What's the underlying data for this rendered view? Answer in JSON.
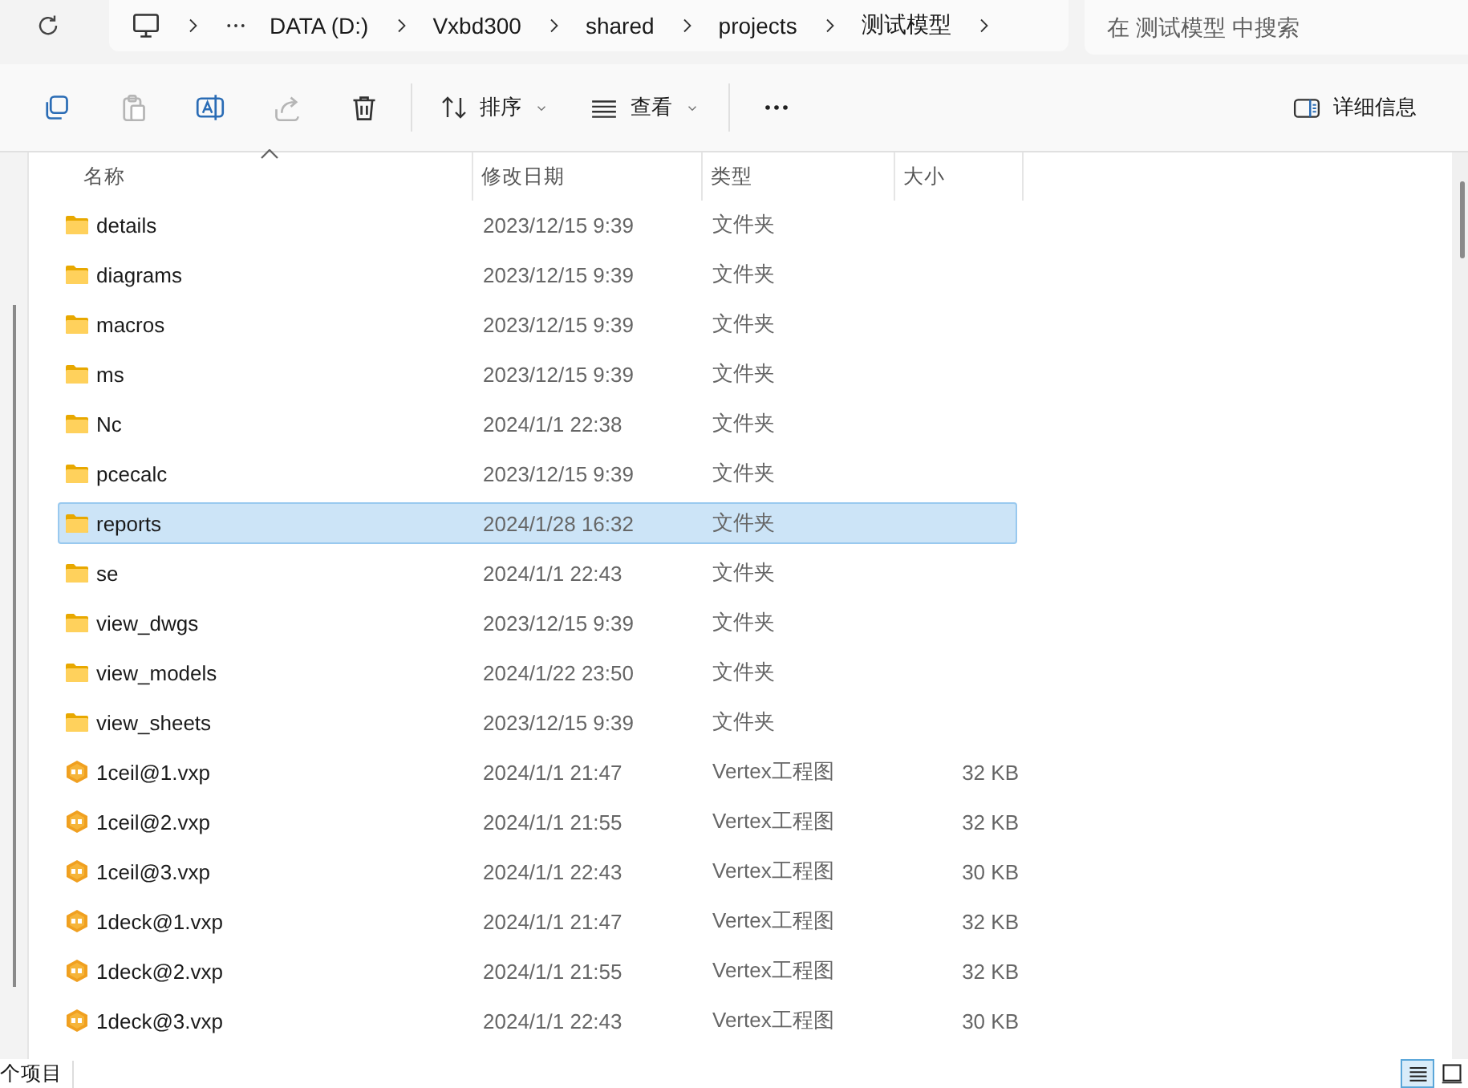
{
  "address_bar": {
    "items": [
      "DATA (D:)",
      "Vxbd300",
      "shared",
      "projects",
      "测试模型"
    ]
  },
  "search": {
    "placeholder": "在 测试模型 中搜索"
  },
  "toolbar": {
    "actions": [
      {
        "kind": "copy",
        "disabled": false
      },
      {
        "kind": "paste",
        "disabled": true
      },
      {
        "kind": "rename",
        "disabled": false
      },
      {
        "kind": "share",
        "disabled": true
      },
      {
        "kind": "delete",
        "disabled": false
      }
    ],
    "sort": "排序",
    "view": "查看",
    "details": "详细信息"
  },
  "table": {
    "columns": [
      {
        "label": "名称",
        "sorted": true
      },
      {
        "label": "修改日期",
        "sorted": false
      },
      {
        "label": "类型",
        "sorted": false
      },
      {
        "label": "大小",
        "sorted": false
      }
    ],
    "rows": [
      {
        "kind": "folder",
        "name": "details",
        "modified": "2023/12/15 9:39",
        "type": "文件夹",
        "selected": false
      },
      {
        "kind": "folder",
        "name": "diagrams",
        "modified": "2023/12/15 9:39",
        "type": "文件夹",
        "selected": false
      },
      {
        "kind": "folder",
        "name": "macros",
        "modified": "2023/12/15 9:39",
        "type": "文件夹",
        "selected": false
      },
      {
        "kind": "folder",
        "name": "ms",
        "modified": "2023/12/15 9:39",
        "type": "文件夹",
        "selected": false
      },
      {
        "kind": "folder",
        "name": "Nc",
        "modified": "2024/1/1 22:38",
        "type": "文件夹",
        "selected": false
      },
      {
        "kind": "folder",
        "name": "pcecalc",
        "modified": "2023/12/15 9:39",
        "type": "文件夹",
        "selected": false
      },
      {
        "kind": "folder",
        "name": "reports",
        "modified": "2024/1/28 16:32",
        "type": "文件夹",
        "selected": true
      },
      {
        "kind": "folder",
        "name": "se",
        "modified": "2024/1/1 22:43",
        "type": "文件夹",
        "selected": false
      },
      {
        "kind": "folder",
        "name": "view_dwgs",
        "modified": "2023/12/15 9:39",
        "type": "文件夹",
        "selected": false
      },
      {
        "kind": "folder",
        "name": "view_models",
        "modified": "2024/1/22 23:50",
        "type": "文件夹",
        "selected": false
      },
      {
        "kind": "folder",
        "name": "view_sheets",
        "modified": "2023/12/15 9:39",
        "type": "文件夹",
        "selected": false
      },
      {
        "kind": "file",
        "name": "1ceil@1.vxp",
        "modified": "2024/1/1 21:47",
        "type": "Vertex工程图",
        "size": "32 KB",
        "selected": false
      },
      {
        "kind": "file",
        "name": "1ceil@2.vxp",
        "modified": "2024/1/1 21:55",
        "type": "Vertex工程图",
        "size": "32 KB",
        "selected": false
      },
      {
        "kind": "file",
        "name": "1ceil@3.vxp",
        "modified": "2024/1/1 22:43",
        "type": "Vertex工程图",
        "size": "30 KB",
        "selected": false
      },
      {
        "kind": "file",
        "name": "1deck@1.vxp",
        "modified": "2024/1/1 21:47",
        "type": "Vertex工程图",
        "size": "32 KB",
        "selected": false
      },
      {
        "kind": "file",
        "name": "1deck@2.vxp",
        "modified": "2024/1/1 21:55",
        "type": "Vertex工程图",
        "size": "32 KB",
        "selected": false
      },
      {
        "kind": "file",
        "name": "1deck@3.vxp",
        "modified": "2024/1/1 22:43",
        "type": "Vertex工程图",
        "size": "30 KB",
        "selected": false
      }
    ]
  },
  "status_bar": {
    "text": "个项目",
    "views": [
      {
        "kind": "details",
        "selected": true
      },
      {
        "kind": "tiles",
        "selected": false
      }
    ]
  }
}
